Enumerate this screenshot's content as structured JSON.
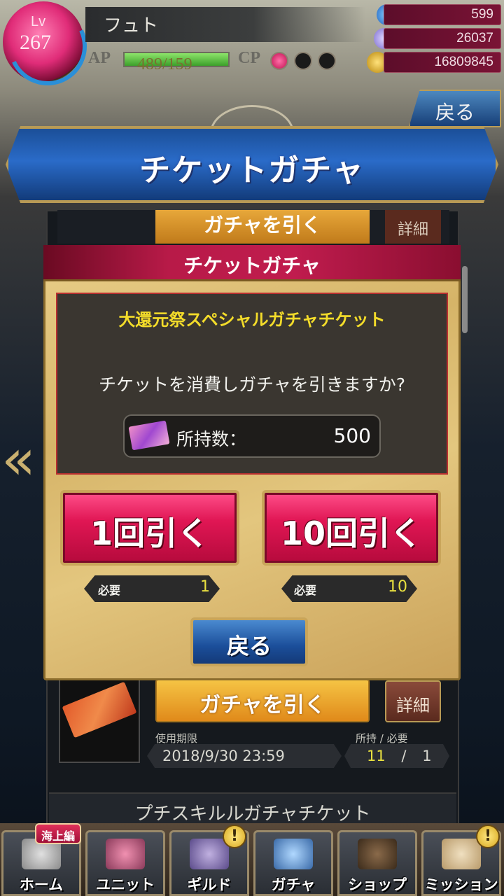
{
  "player": {
    "level_label": "Lv",
    "level": "267",
    "name": "フュト"
  },
  "stats": {
    "ap_label": "AP",
    "ap_value": "489/159",
    "ap_fraction": 1.0,
    "cp_label": "CP",
    "cp_filled": 1,
    "cp_total": 3
  },
  "currency": {
    "gems": "599",
    "crystals": "26037",
    "gold": "16809845"
  },
  "header": {
    "back_label": "戻る",
    "title": "チケットガチャ"
  },
  "background_list": {
    "top_pull_label": "ガチャを引く",
    "top_detail_label": "詳細",
    "pull_label": "ガチャを引く",
    "detail_label": "詳細",
    "expiry_label": "使用期限",
    "expiry_value": "2018/9/30 23:59",
    "owned_label": "所持 / 必要",
    "owned_value": "11",
    "required_value": "1",
    "owned_sep": "/",
    "next_item": "プチスキルルガチャチケット"
  },
  "modal": {
    "title": "チケットガチャ",
    "item_name": "大還元祭スペシャルガチャチケット",
    "question": "チケットを消費しガチャを引きますか?",
    "owned_label": "所持数：",
    "owned_count": "500",
    "pull_single": {
      "label": "1回引く",
      "req_label": "必要",
      "req_value": "1"
    },
    "pull_ten": {
      "label": "10回引く",
      "req_label": "必要",
      "req_value": "10"
    },
    "back_label": "戻る"
  },
  "nav": [
    {
      "label": "ホーム",
      "tag": "海上編",
      "alert": ""
    },
    {
      "label": "ユニット",
      "alert": ""
    },
    {
      "label": "ギルド",
      "alert": "!"
    },
    {
      "label": "ガチャ",
      "alert": ""
    },
    {
      "label": "ショップ",
      "alert": ""
    },
    {
      "label": "ミッション",
      "alert": "!"
    }
  ],
  "colors": {
    "accent_pink": "#e01654",
    "accent_blue": "#1b4e9a",
    "gold": "#c9a55a",
    "item_yellow": "#f3dc2a"
  }
}
